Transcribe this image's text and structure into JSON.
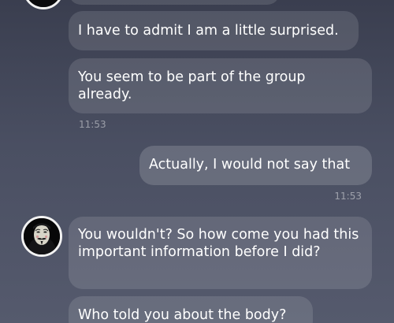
{
  "conversation": {
    "messages": [
      {
        "sender": "contact",
        "text": "I have to admit I am a little surprised."
      },
      {
        "sender": "contact",
        "text": "You seem to be part of the group already."
      },
      {
        "sender": "contact",
        "time": "11:53"
      },
      {
        "sender": "me",
        "text": "Actually, I would not say that",
        "time": "11:53"
      },
      {
        "sender": "contact",
        "text": "You wouldn't? So how come you had this important information before I did?"
      },
      {
        "sender": "contact",
        "text": "Who told you about the body?"
      }
    ],
    "time_contact": "11:53",
    "time_me": "11:53"
  },
  "contact": {
    "avatar": "masked-figure-avatar"
  }
}
